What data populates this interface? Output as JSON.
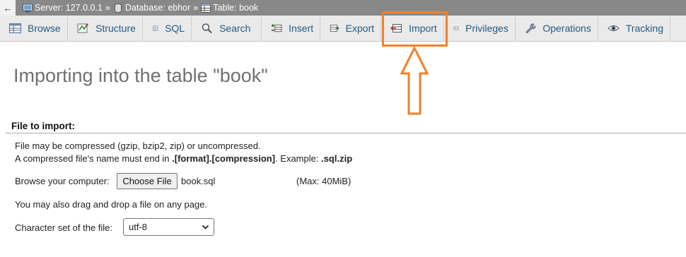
{
  "breadcrumb": {
    "back_glyph": "←",
    "server": "Server: 127.0.0.1",
    "database": "Database: ebhor",
    "table": "Table: book",
    "separator": "»"
  },
  "tabs": [
    {
      "label": "Browse",
      "icon": "browse-icon"
    },
    {
      "label": "Structure",
      "icon": "structure-icon"
    },
    {
      "label": "SQL",
      "icon": "sql-icon"
    },
    {
      "label": "Search",
      "icon": "search-icon"
    },
    {
      "label": "Insert",
      "icon": "insert-icon"
    },
    {
      "label": "Export",
      "icon": "export-icon"
    },
    {
      "label": "Import",
      "icon": "import-icon",
      "active": true
    },
    {
      "label": "Privileges",
      "icon": "privileges-icon"
    },
    {
      "label": "Operations",
      "icon": "operations-icon"
    },
    {
      "label": "Tracking",
      "icon": "tracking-icon"
    }
  ],
  "colors": {
    "accent_highlight": "#f0812a",
    "tab_text": "#235a81",
    "breadcrumb_bg": "#888888"
  },
  "main": {
    "title": "Importing into the table \"book\"",
    "section_legend": "File to import:",
    "compress_note": "File may be compressed (gzip, bzip2, zip) or uncompressed.",
    "name_note_prefix": "A compressed file's name must end in ",
    "name_note_format": ".[format].[compression]",
    "name_note_mid": ". Example: ",
    "name_note_example": ".sql.zip",
    "browse_label": "Browse your computer:",
    "choose_button": "Choose File",
    "file_name": "book.sql",
    "max_size": "(Max: 40MiB)",
    "drag_note": "You may also drag and drop a file on any page.",
    "charset_label": "Character set of the file:",
    "charset_value": "utf-8"
  }
}
